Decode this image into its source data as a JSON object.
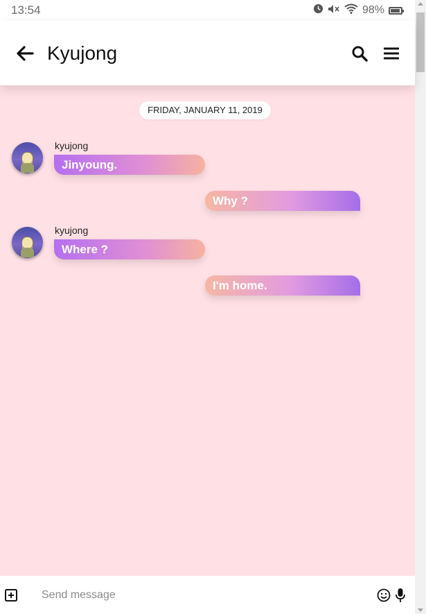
{
  "status_bar": {
    "time": "13:54",
    "battery_percent": "98%",
    "icons": [
      "alarm-icon",
      "mute-icon",
      "wifi-icon",
      "battery-icon"
    ]
  },
  "header": {
    "title": "Kyujong",
    "icons": [
      "back-arrow-icon",
      "search-icon",
      "menu-icon"
    ]
  },
  "chat": {
    "date_label": "FRIDAY, JANUARY 11, 2019",
    "messages": [
      {
        "direction": "incoming",
        "sender": "kyujong",
        "text": "Jinyoung."
      },
      {
        "direction": "outgoing",
        "text": "Why ?"
      },
      {
        "direction": "incoming",
        "sender": "kyujong",
        "text": "Where ?"
      },
      {
        "direction": "outgoing",
        "text": "I'm home."
      }
    ]
  },
  "composer": {
    "placeholder": "Send message",
    "value": "",
    "icons": [
      "add-box-icon",
      "emoji-icon",
      "mic-icon"
    ]
  },
  "colors": {
    "chat_background": "#ffe0e5",
    "incoming_gradient": [
      "#b56ff0",
      "#f6b2a0"
    ],
    "outgoing_gradient": [
      "#f6b7a3",
      "#a56ee8"
    ]
  }
}
